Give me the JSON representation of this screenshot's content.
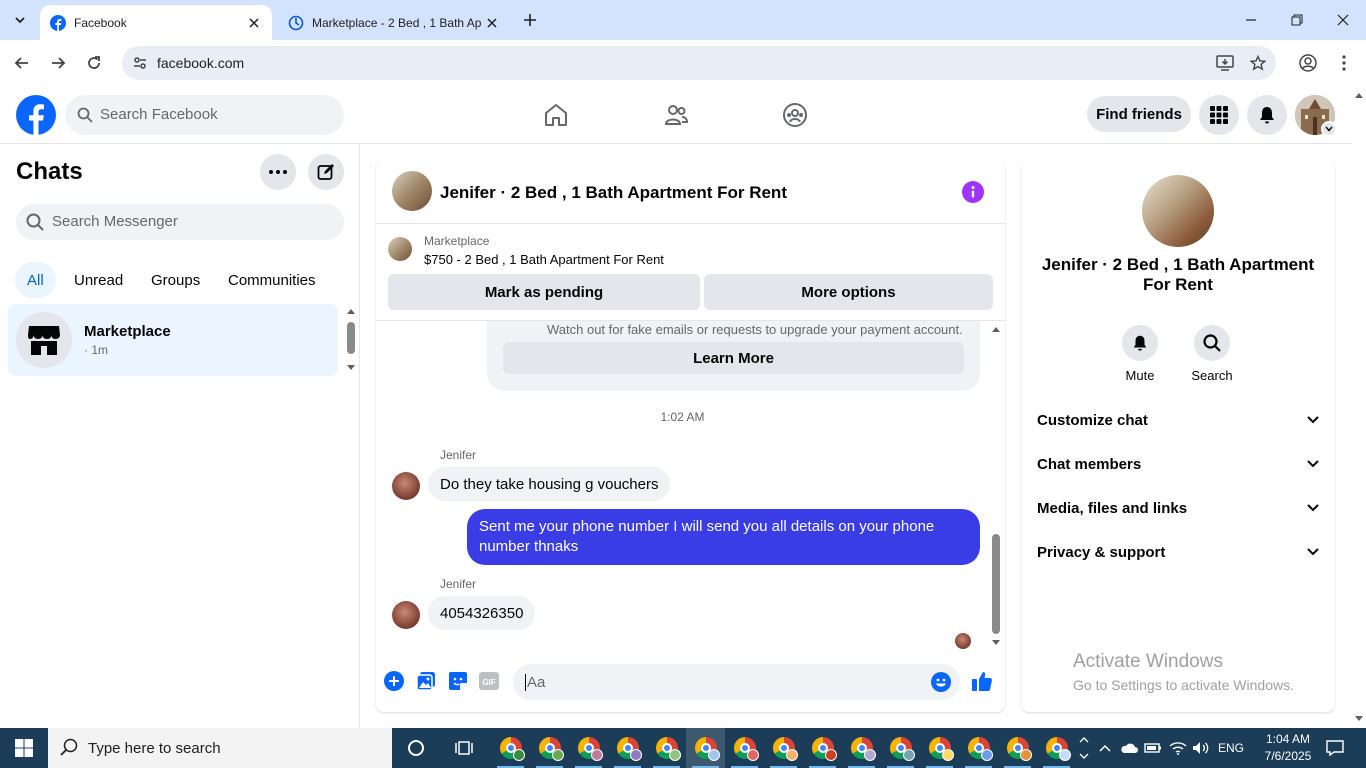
{
  "browser": {
    "tabs": [
      {
        "title": "Facebook",
        "active": true
      },
      {
        "title": "Marketplace - 2 Bed , 1 Bath Ap",
        "active": false
      }
    ],
    "url": "facebook.com"
  },
  "fb_header": {
    "search_placeholder": "Search Facebook",
    "find_friends": "Find friends"
  },
  "sidebar": {
    "title": "Chats",
    "search_placeholder": "Search Messenger",
    "filters": [
      "All",
      "Unread",
      "Groups",
      "Communities"
    ],
    "active_filter": "All",
    "chats": [
      {
        "name": "Marketplace",
        "sub": "· 1m"
      }
    ]
  },
  "conversation": {
    "title": "Jenifer · 2 Bed , 1 Bath Apartment For Rent",
    "marketplace": {
      "label": "Marketplace",
      "listing": "$750 - 2 Bed , 1 Bath Apartment For Rent",
      "mark_pending": "Mark as pending",
      "more_options": "More options"
    },
    "warning_text": "Watch out for fake emails or requests to upgrade your payment account.",
    "learn_more": "Learn More",
    "timestamp": "1:02 AM",
    "messages": [
      {
        "sender": "Jenifer",
        "direction": "in",
        "text": "Do they take housing g vouchers"
      },
      {
        "direction": "out",
        "text": "Sent me your phone number I will send you all details on your phone number thnaks"
      },
      {
        "sender": "Jenifer",
        "direction": "in",
        "text": "4054326350"
      }
    ],
    "composer_placeholder": "Aa"
  },
  "info_panel": {
    "name": "Jenifer · 2 Bed , 1 Bath Apartment For Rent",
    "actions": [
      {
        "label": "Mute",
        "icon": "bell-icon"
      },
      {
        "label": "Search",
        "icon": "search-icon"
      }
    ],
    "sections": [
      "Customize chat",
      "Chat members",
      "Media, files and links",
      "Privacy & support"
    ]
  },
  "watermark": {
    "line1": "Activate Windows",
    "line2": "Go to Settings to activate Windows."
  },
  "taskbar": {
    "search_placeholder": "Type here to search",
    "language": "ENG",
    "time": "1:04 AM",
    "date": "7/6/2025"
  },
  "colors": {
    "facebook_blue": "#0866ff",
    "outgoing_bubble": "#3a3de6",
    "info_purple": "#a033ff",
    "taskbar": "#1c3d57"
  }
}
